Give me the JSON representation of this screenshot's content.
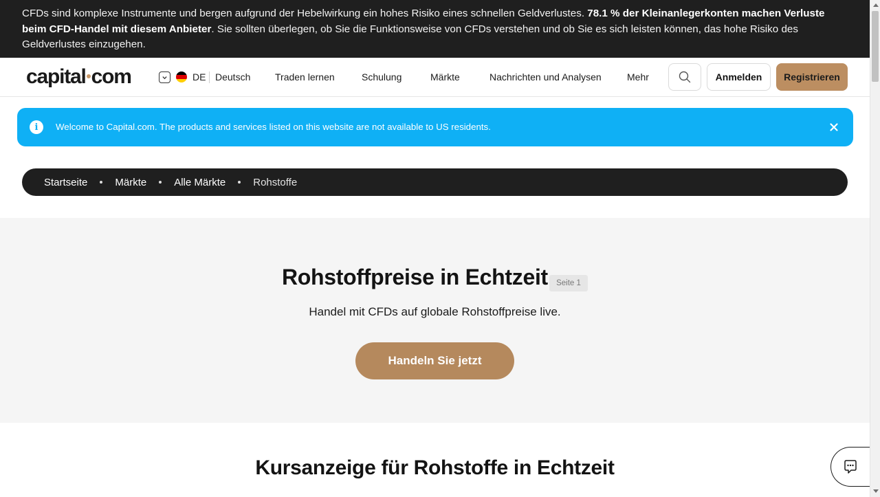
{
  "risk_banner": {
    "text_before": "CFDs sind komplexe Instrumente und bergen aufgrund der Hebelwirkung ein hohes Risiko eines schnellen Geldverlustes. ",
    "text_bold": "78.1 % der Kleinanlegerkonten machen Verluste beim CFD-Handel mit diesem Anbieter",
    "text_after": ". Sie sollten überlegen, ob Sie die Funktionsweise von CFDs verstehen und ob Sie es sich leisten können, das hohe Risiko des Geldverlustes einzugehen."
  },
  "header": {
    "logo_part1": "capital",
    "logo_part2": "com",
    "language": {
      "code": "DE",
      "name": "Deutsch"
    },
    "nav": [
      "Traden lernen",
      "Schulung",
      "Märkte",
      "Nachrichten und Analysen",
      "Mehr"
    ],
    "login_label": "Anmelden",
    "signup_label": "Registrieren"
  },
  "info_bar": {
    "text": "Welcome to Capital.com. The products and services listed on this website are not available to US residents."
  },
  "breadcrumb": [
    "Startseite",
    "Märkte",
    "Alle Märkte",
    "Rohstoffe"
  ],
  "hero": {
    "title": "Rohstoffpreise in Echtzeit",
    "page_badge": "Seite 1",
    "subtitle": "Handel mit CFDs auf globale Rohstoffpreise live.",
    "cta_label": "Handeln Sie jetzt"
  },
  "section": {
    "title": "Kursanzeige für Rohstoffe in Echtzeit"
  },
  "colors": {
    "accent": "#b5895d",
    "info": "#0fb0f5",
    "dark": "#1f1f1f"
  }
}
